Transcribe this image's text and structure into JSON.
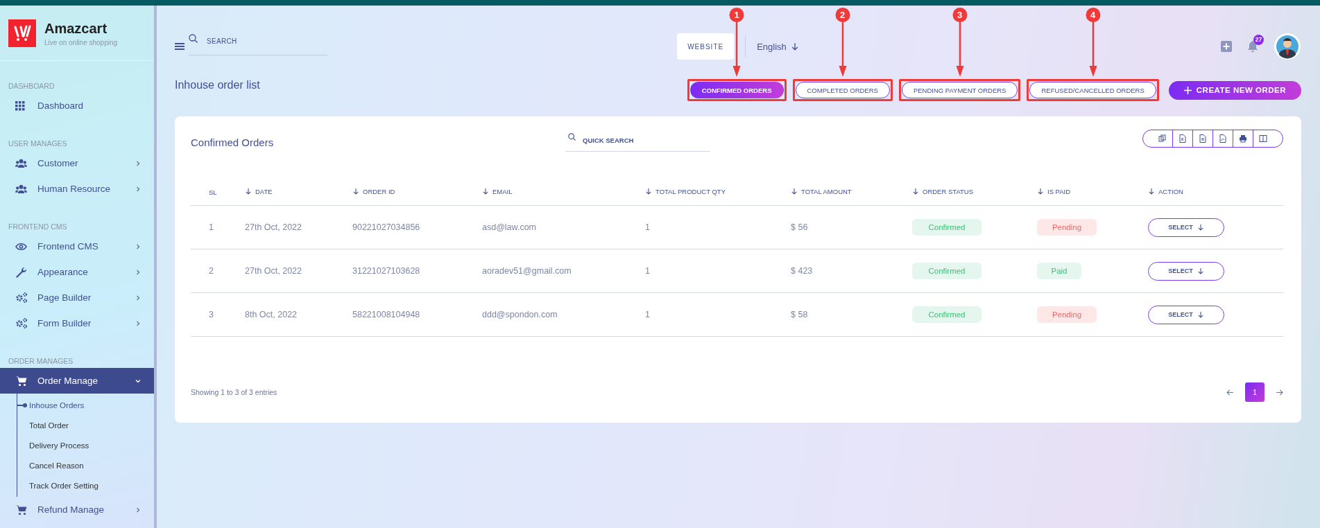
{
  "sidebar": {
    "brand": {
      "name": "Amazcart",
      "tagline": "Live on online shopping"
    },
    "sections": [
      {
        "title": "DASHBOARD",
        "items": [
          {
            "label": "Dashboard",
            "selected": false
          }
        ]
      },
      {
        "title": "USER MANAGES",
        "items": [
          {
            "label": "Customer",
            "expanded": false,
            "selected": false
          },
          {
            "label": "Human Resource",
            "expanded": false,
            "selected": false
          }
        ]
      },
      {
        "title": "FRONTEND CMS",
        "items": [
          {
            "label": "Frontend CMS",
            "expanded": false,
            "selected": false
          },
          {
            "label": "Appearance",
            "expanded": false,
            "selected": false
          },
          {
            "label": "Page Builder",
            "expanded": false,
            "selected": false
          },
          {
            "label": "Form Builder",
            "expanded": false,
            "selected": false
          }
        ]
      },
      {
        "title": "ORDER MANAGES",
        "items": [
          {
            "label": "Order Manage",
            "expanded": true,
            "selected": true,
            "children": [
              {
                "label": "Inhouse Orders",
                "selected": true
              },
              {
                "label": "Total Order",
                "selected": false
              },
              {
                "label": "Delivery Process",
                "selected": false
              },
              {
                "label": "Cancel Reason",
                "selected": false
              },
              {
                "label": "Track Order Setting",
                "selected": false
              }
            ]
          },
          {
            "label": "Refund Manage",
            "expanded": false,
            "selected": false
          }
        ]
      }
    ]
  },
  "header": {
    "search": {
      "placeholder": "SEARCH"
    },
    "website_button": "WEBSITE",
    "language": "English",
    "notification_count": "27"
  },
  "page_title": "Inhouse order list",
  "tabs": [
    {
      "label": "CONFIRMED ORDERS",
      "selected": true,
      "annotation": "1"
    },
    {
      "label": "COMPLETED ORDERS",
      "selected": false,
      "annotation": "2"
    },
    {
      "label": "PENDING PAYMENT ORDERS",
      "selected": false,
      "annotation": "3"
    },
    {
      "label": "REFUSED/CANCELLED ORDERS",
      "selected": false,
      "annotation": "4"
    }
  ],
  "create_button": "CREATE NEW ORDER",
  "card": {
    "title": "Confirmed Orders",
    "quick_search": {
      "placeholder": "QUICK SEARCH"
    },
    "table": {
      "columns": [
        {
          "label": "SL",
          "sort_arrow": false
        },
        {
          "label": "DATE",
          "sort_arrow": true
        },
        {
          "label": "ORDER ID",
          "sort_arrow": true
        },
        {
          "label": "EMAIL",
          "sort_arrow": true
        },
        {
          "label": "TOTAL PRODUCT QTY",
          "sort_arrow": true
        },
        {
          "label": "TOTAL AMOUNT",
          "sort_arrow": true
        },
        {
          "label": "ORDER STATUS",
          "sort_arrow": true
        },
        {
          "label": "IS PAID",
          "sort_arrow": true
        },
        {
          "label": "ACTION",
          "sort_arrow": true
        }
      ],
      "rows": [
        {
          "sl": "1",
          "date": "27th Oct, 2022",
          "order_id": "90221027034856",
          "email": "asd@law.com",
          "qty": "1",
          "amount": "$ 56",
          "order_status": {
            "label": "Confirmed",
            "kind": "success"
          },
          "is_paid": {
            "label": "Pending",
            "kind": "danger"
          },
          "action": "SELECT"
        },
        {
          "sl": "2",
          "date": "27th Oct, 2022",
          "order_id": "31221027103628",
          "email": "aoradev51@gmail.com",
          "qty": "1",
          "amount": "$ 423",
          "order_status": {
            "label": "Confirmed",
            "kind": "success"
          },
          "is_paid": {
            "label": "Paid",
            "kind": "success"
          },
          "action": "SELECT"
        },
        {
          "sl": "3",
          "date": "8th Oct, 2022",
          "order_id": "58221008104948",
          "email": "ddd@spondon.com",
          "qty": "1",
          "amount": "$ 58",
          "order_status": {
            "label": "Confirmed",
            "kind": "success"
          },
          "is_paid": {
            "label": "Pending",
            "kind": "danger"
          },
          "action": "SELECT"
        }
      ]
    },
    "footer": {
      "entries_info": "Showing 1 to 3 of 3 entries",
      "pages": [
        {
          "label": "1",
          "selected": true
        }
      ]
    }
  }
}
